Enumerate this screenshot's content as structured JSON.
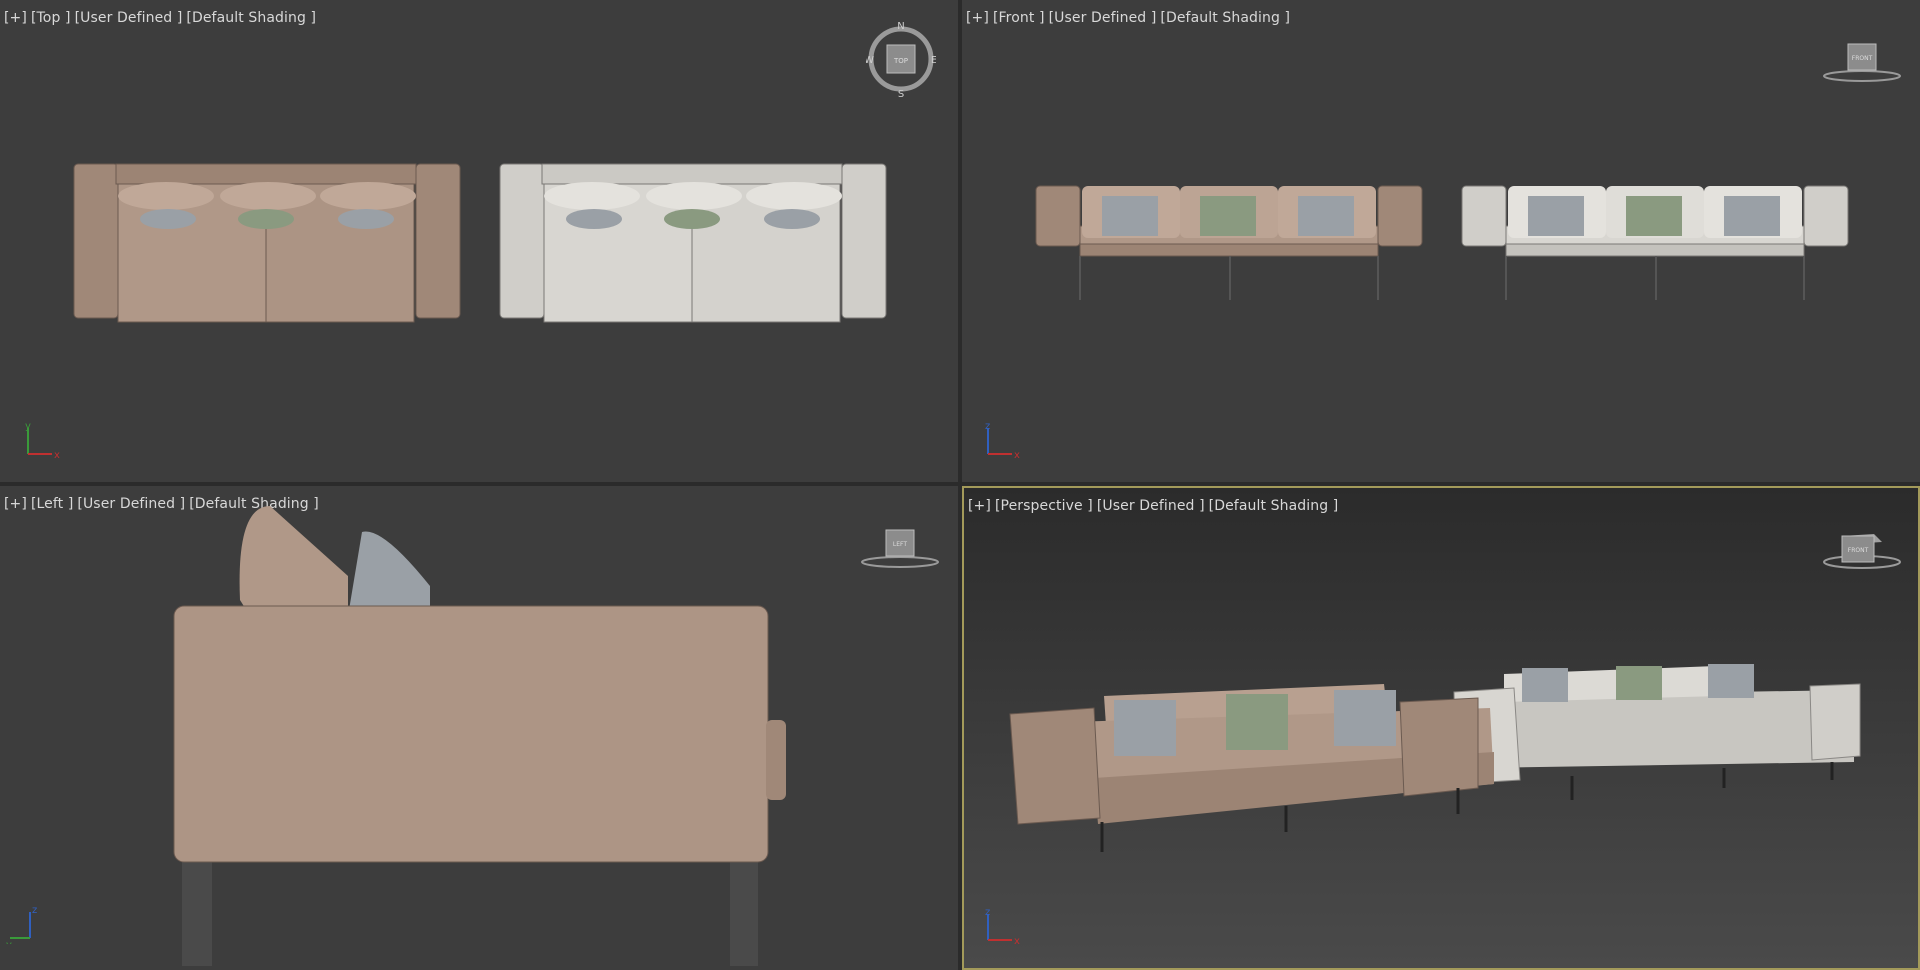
{
  "viewports": {
    "top": {
      "menu": "[+]",
      "view": "[Top ]",
      "camera": "[User Defined ]",
      "shading": "[Default Shading ]"
    },
    "front": {
      "menu": "[+]",
      "view": "[Front ]",
      "camera": "[User Defined ]",
      "shading": "[Default Shading ]"
    },
    "left": {
      "menu": "[+]",
      "view": "[Left ]",
      "camera": "[User Defined ]",
      "shading": "[Default Shading ]"
    },
    "persp": {
      "menu": "[+]",
      "view": "[Perspective ]",
      "camera": "[User Defined ]",
      "shading": "[Default Shading ]"
    }
  },
  "viewcube": {
    "top": {
      "face": "TOP",
      "compass": {
        "n": "N",
        "s": "S",
        "e": "E",
        "w": "W"
      }
    },
    "front": {
      "face": "FRONT"
    },
    "left": {
      "face": "LEFT"
    },
    "persp": {
      "face": "FRONT"
    }
  },
  "axes": {
    "top": {
      "a": "y",
      "b": "x"
    },
    "front": {
      "a": "z",
      "b": "x"
    },
    "left": {
      "a": "z",
      "b": "y"
    },
    "persp": {
      "a": "z",
      "b": "x"
    }
  },
  "colors": {
    "viewport_bg": "#3d3d3d",
    "active_border": "#a39a5a",
    "sofa_taupe": "#a89080",
    "sofa_white": "#cfcdc8",
    "pillow_stripe": "#9aa0a6",
    "pillow_green": "#8a9a80"
  }
}
